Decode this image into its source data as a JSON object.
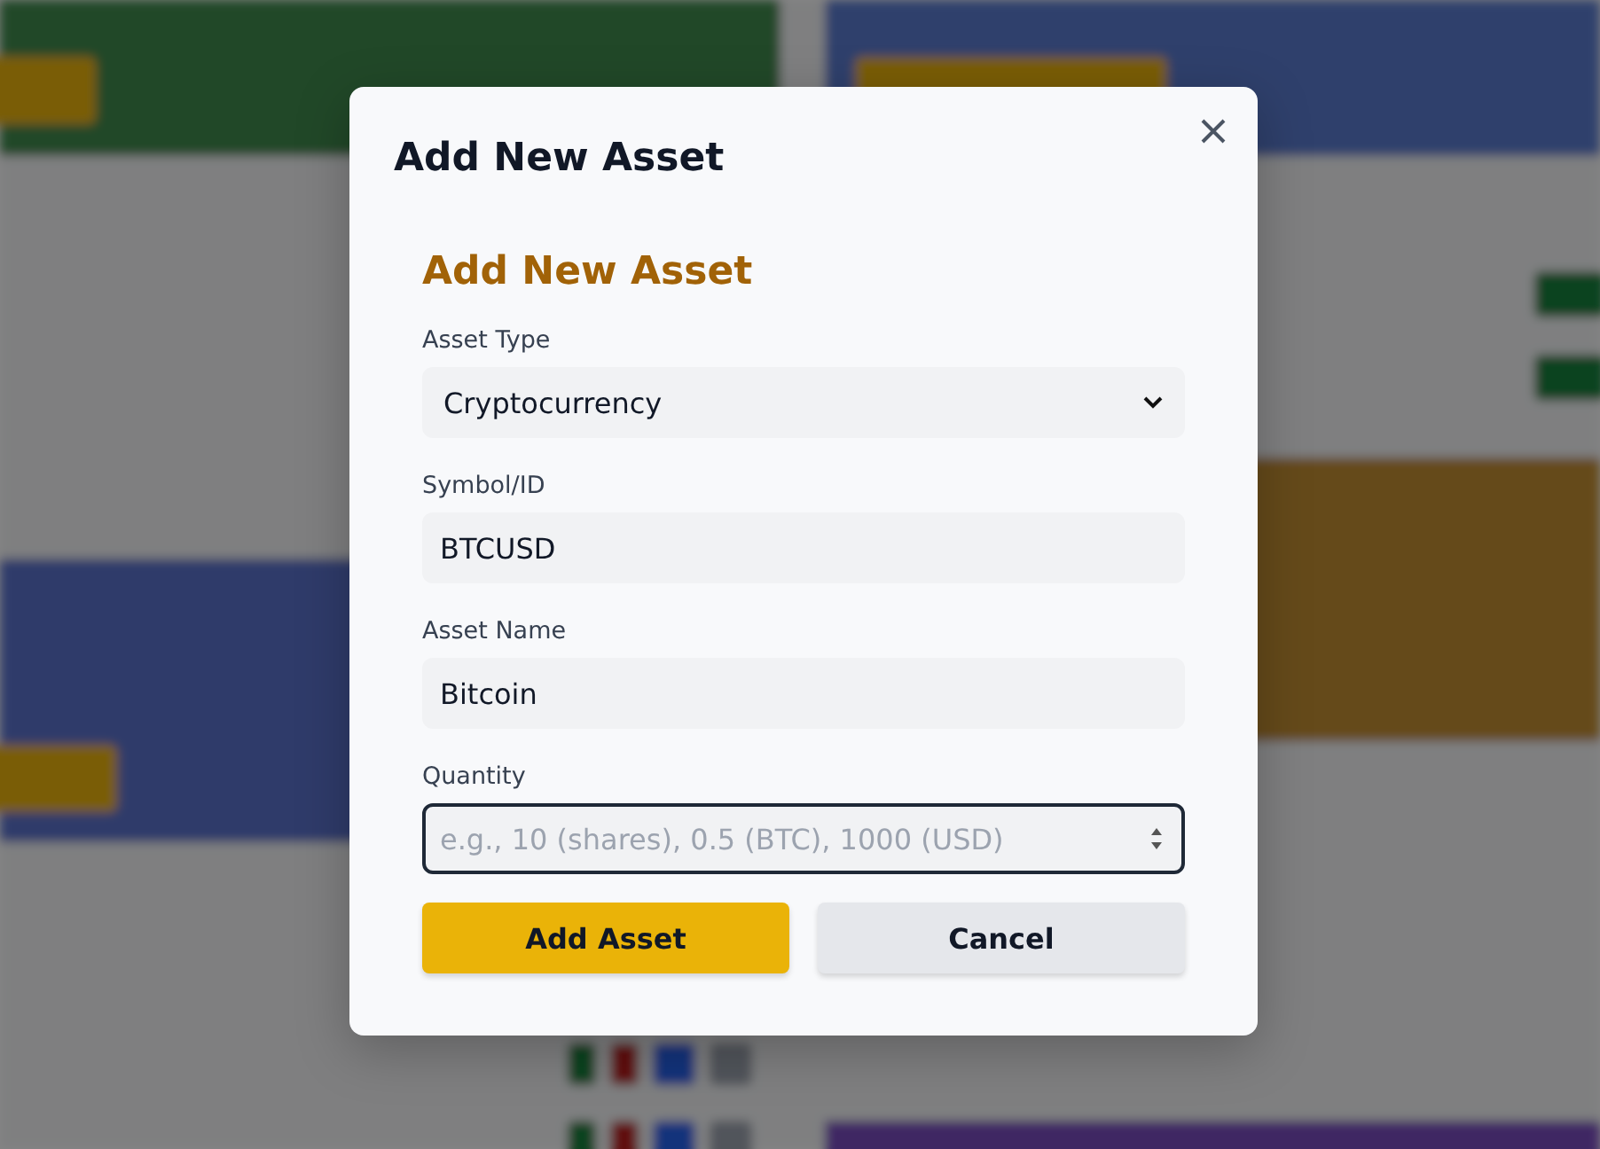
{
  "dialog": {
    "title": "Add New Asset",
    "form_title": "Add New Asset",
    "fields": [
      {
        "kind": "select",
        "label": "Asset Type",
        "value": "Cryptocurrency",
        "focused": false
      },
      {
        "kind": "text",
        "label": "Symbol/ID",
        "value": "BTCUSD",
        "focused": false
      },
      {
        "kind": "text",
        "label": "Asset Name",
        "value": "Bitcoin",
        "focused": false
      },
      {
        "kind": "number",
        "label": "Quantity",
        "placeholder": "e.g., 10 (shares), 0.5 (BTC), 1000 (USD)",
        "focused": true
      }
    ],
    "buttons": [
      {
        "label": "Add Asset",
        "kind": "primary"
      },
      {
        "label": "Cancel",
        "kind": "secondary"
      }
    ]
  }
}
